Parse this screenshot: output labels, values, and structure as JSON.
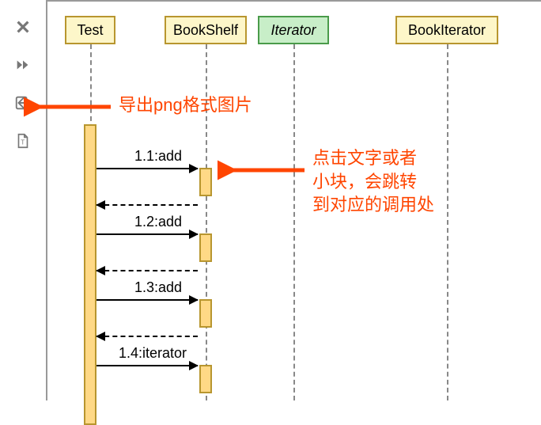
{
  "toolbar": {
    "close": "close",
    "forward": "fast-forward",
    "export": "export",
    "text": "text-file"
  },
  "lifelines": {
    "test": "Test",
    "bookshelf": "BookShelf",
    "iterator": "Iterator",
    "bookiterator": "BookIterator"
  },
  "messages": {
    "m1": "1.1:add",
    "m2": "1.2:add",
    "m3": "1.3:add",
    "m4": "1.4:iterator"
  },
  "annotations": {
    "export_png": "导出png格式图片",
    "click_hint_l1": "点击文字或者",
    "click_hint_l2": "小块，会跳转",
    "click_hint_l3": "到对应的调用处"
  }
}
